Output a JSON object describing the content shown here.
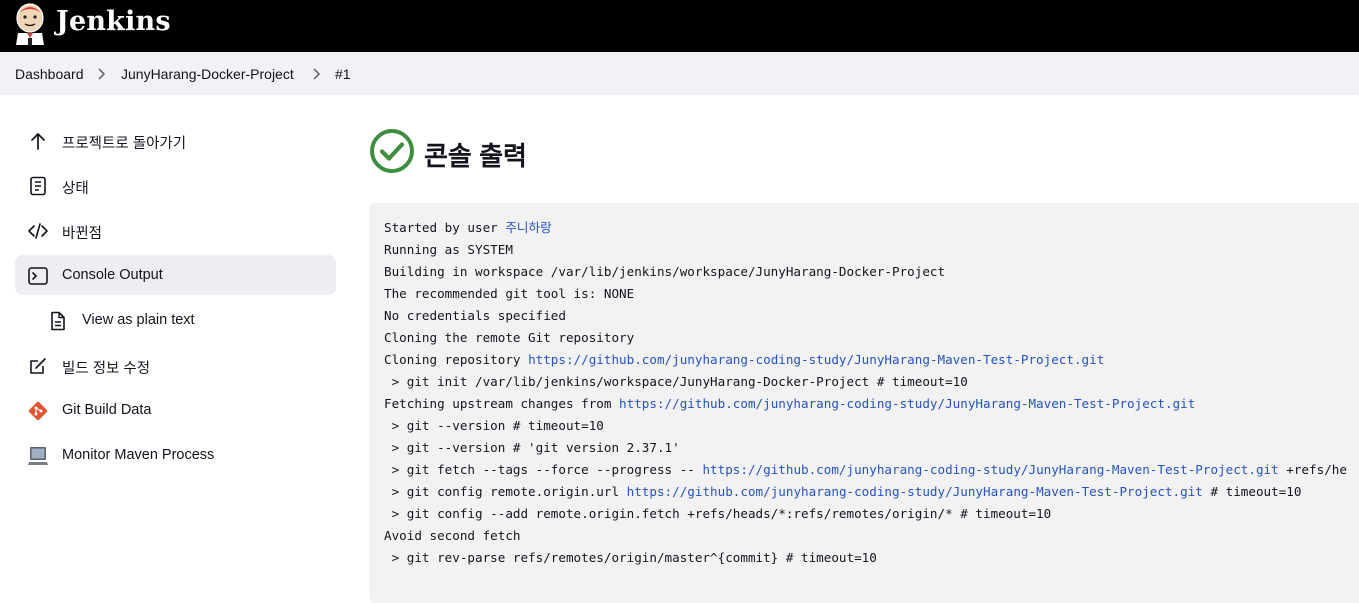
{
  "header": {
    "brand": "Jenkins",
    "logo": "jenkins-butler-logo"
  },
  "breadcrumb": [
    "Dashboard",
    "JunyHarang-Docker-Project",
    "#1"
  ],
  "sidebar": {
    "items": [
      {
        "label": "프로젝트로 돌아가기",
        "icon": "arrow-up-icon"
      },
      {
        "label": "상태",
        "icon": "document-icon"
      },
      {
        "label": "바뀐점",
        "icon": "code-icon"
      },
      {
        "label": "Console Output",
        "icon": "terminal-icon",
        "active": true
      },
      {
        "label": "View as plain text",
        "icon": "text-file-icon"
      },
      {
        "label": "빌드 정보 수정",
        "icon": "edit-icon"
      },
      {
        "label": "Git Build Data",
        "icon": "git-icon"
      },
      {
        "label": "Monitor Maven Process",
        "icon": "computer-icon"
      }
    ]
  },
  "main": {
    "title": "콘솔 출력",
    "status": "success"
  },
  "console": {
    "lines": [
      {
        "text": "Started by user ",
        "link": "주니하랑"
      },
      {
        "text": "Running as SYSTEM"
      },
      {
        "text": "Building in workspace /var/lib/jenkins/workspace/JunyHarang-Docker-Project"
      },
      {
        "text": "The recommended git tool is: NONE"
      },
      {
        "text": "No credentials specified"
      },
      {
        "text": "Cloning the remote Git repository"
      },
      {
        "text": "Cloning repository ",
        "link": "https://github.com/junyharang-coding-study/JunyHarang-Maven-Test-Project.git"
      },
      {
        "text": " > git init /var/lib/jenkins/workspace/JunyHarang-Docker-Project # timeout=10"
      },
      {
        "text": "Fetching upstream changes from ",
        "link": "https://github.com/junyharang-coding-study/JunyHarang-Maven-Test-Project.git"
      },
      {
        "text": " > git --version # timeout=10"
      },
      {
        "text": " > git --version # 'git version 2.37.1'"
      },
      {
        "text": " > git fetch --tags --force --progress -- ",
        "link": "https://github.com/junyharang-coding-study/JunyHarang-Maven-Test-Project.git",
        "after": " +refs/he"
      },
      {
        "text": " > git config remote.origin.url ",
        "link": "https://github.com/junyharang-coding-study/JunyHarang-Maven-Test-Project.git",
        "after": " # timeout=10"
      },
      {
        "text": " > git config --add remote.origin.fetch +refs/heads/*:refs/remotes/origin/* # timeout=10"
      },
      {
        "text": "Avoid second fetch"
      },
      {
        "text": " > git rev-parse refs/remotes/origin/master^{commit} # timeout=10"
      }
    ]
  },
  "colors": {
    "success": "#3d8f3f",
    "link": "#2553c4",
    "git": "#e2542f"
  }
}
